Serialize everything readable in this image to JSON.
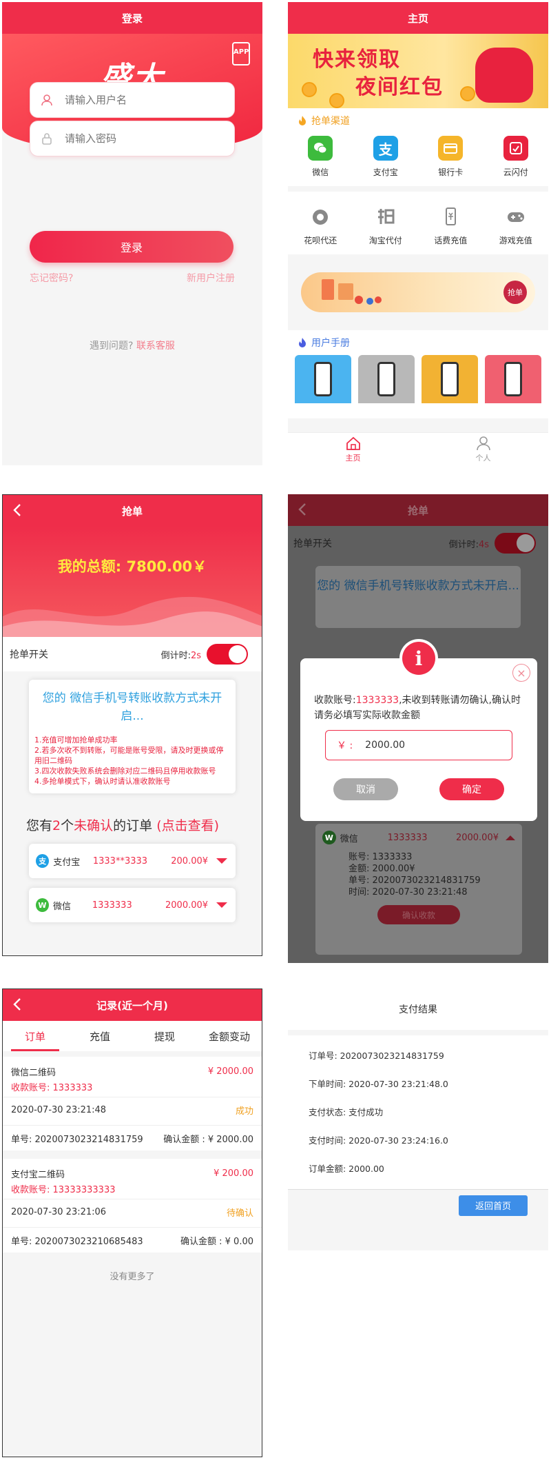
{
  "login": {
    "title": "登录",
    "logo": "盛大",
    "app_badge": "APP",
    "username_placeholder": "请输入用户名",
    "password_placeholder": "请输入密码",
    "login_button": "登录",
    "forgot": "忘记密码?",
    "register": "新用户注册",
    "help_q": "遇到问题?",
    "help_link": "联系客服"
  },
  "home": {
    "title": "主页",
    "banner_line1": "快来领取",
    "banner_line2": "夜间红包",
    "channels_title": "抢单渠道",
    "channels": [
      {
        "label": "微信",
        "icon": "wechat-icon",
        "color": "#3dbb3d"
      },
      {
        "label": "支付宝",
        "icon": "alipay-icon",
        "color": "#1ea0e6"
      },
      {
        "label": "银行卡",
        "icon": "bank-card-icon",
        "color": "#f5b52a"
      },
      {
        "label": "云闪付",
        "icon": "unionpay-icon",
        "color": "#e8223e"
      }
    ],
    "services": [
      {
        "label": "花呗代还",
        "icon": "huabei-icon"
      },
      {
        "label": "淘宝代付",
        "icon": "taobao-icon"
      },
      {
        "label": "话费充值",
        "icon": "phone-recharge-icon"
      },
      {
        "label": "游戏充值",
        "icon": "gamepad-icon"
      }
    ],
    "promo_badge": "抢单",
    "manual_title": "用户手册",
    "tab_home": "主页",
    "tab_me": "个人"
  },
  "grab": {
    "title": "抢单",
    "total": "我的总额: 7800.00￥",
    "switch_label": "抢单开关",
    "countdown_prefix": "倒计时:",
    "countdown_value": "2s",
    "notice_title": "您的 微信手机号转账收款方式未开启...",
    "notice_lines": [
      "1.充值可增加抢单成功率",
      "2.若多次收不到转账，可能是账号受限，请及时更换或停用旧二维码",
      "3.四次收款失败系统会删除对应二维码且停用收款账号",
      "4.多抢单模式下，确认时请认准收款账号"
    ],
    "orders_prefix": "您有",
    "orders_count": "2",
    "orders_mid": "个",
    "orders_unconfirmed": "未确认",
    "orders_suffix": "的订单",
    "orders_link": "(点击查看)",
    "orders": [
      {
        "name": "支付宝",
        "account": "1333**3333",
        "amount": "200.00¥",
        "icon": "alipay-icon",
        "color": "#1ea0e6"
      },
      {
        "name": "微信",
        "account": "1333333",
        "amount": "2000.00¥",
        "icon": "wechat-icon",
        "color": "#3dbb3d"
      }
    ]
  },
  "dialog_screen": {
    "title": "抢单",
    "switch_label": "抢单开关",
    "countdown_prefix": "倒计时:",
    "countdown_value": "4s",
    "notice_title": "您的 微信手机号转账收款方式未开启...",
    "order": {
      "name": "微信",
      "account": "1333333",
      "amount": "2000.00¥",
      "account_line": "账号: 1333333",
      "amount_line": "金额: 2000.00¥",
      "order_no_line": "单号: 2020073023214831759",
      "time_line": "时间: 2020-07-30 23:21:48",
      "confirm_button": "确认收款"
    },
    "dialog": {
      "text_prefix": "收款账号:",
      "account": "1333333",
      "text_suffix": ",未收到转账请勿确认,确认时请务必填写实际收款金额",
      "currency": "￥ :",
      "amount": "2000.00",
      "cancel": "取消",
      "ok": "确定",
      "badge": "i",
      "close": "×"
    }
  },
  "records": {
    "title": "记录(近一个月)",
    "tabs": [
      "订单",
      "充值",
      "提现",
      "金额变动"
    ],
    "items": [
      {
        "type": "微信二维码",
        "amount": "¥ 2000.00",
        "account": "收款账号: 1333333",
        "time": "2020-07-30 23:21:48",
        "status": "成功",
        "order_no": "单号: 2020073023214831759",
        "confirm": "确认金额 : ¥ 2000.00"
      },
      {
        "type": "支付宝二维码",
        "amount": "¥ 200.00",
        "account": "收款账号: 13333333333",
        "time": "2020-07-30 23:21:06",
        "status": "待确认",
        "order_no": "单号: 2020073023210685483",
        "confirm": "确认金额 : ¥ 0.00"
      }
    ],
    "no_more": "没有更多了"
  },
  "pay_result": {
    "title": "支付结果",
    "rows": [
      "订单号: 2020073023214831759",
      "下单时间: 2020-07-30 23:21:48.0",
      "支付状态: 支付成功",
      "支付时间: 2020-07-30 23:24:16.0",
      "订单金额: 2000.00"
    ],
    "button": "返回首页"
  }
}
